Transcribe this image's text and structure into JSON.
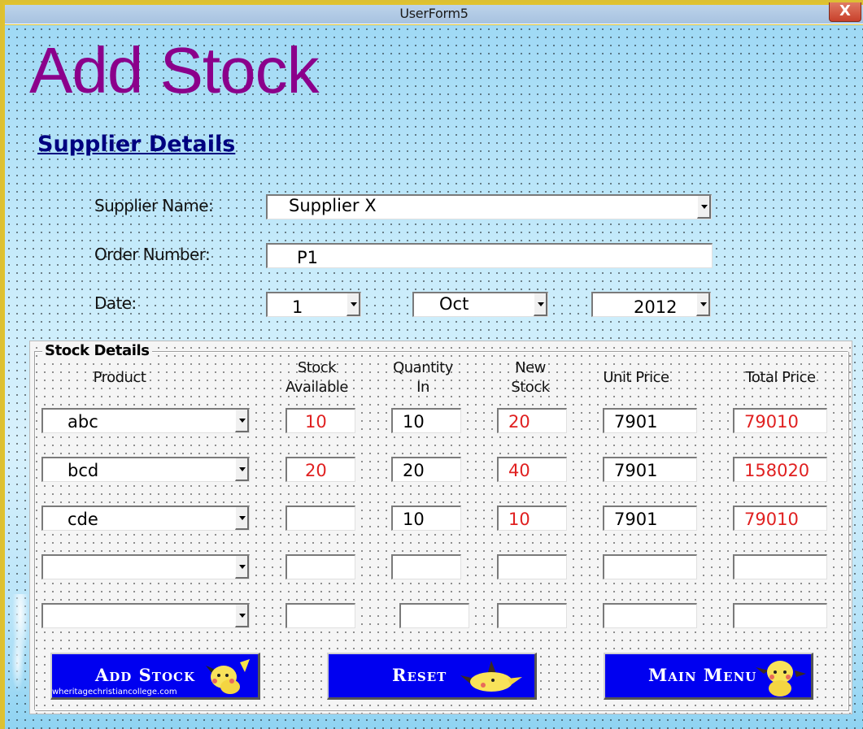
{
  "window": {
    "title": "UserForm5",
    "close_label": "X"
  },
  "heading": "Add Stock",
  "supplier_section": {
    "title": "Supplier Details",
    "supplier_name_label": "Supplier Name:",
    "supplier_name_value": "Supplier X",
    "order_number_label": "Order Number:",
    "order_number_value": "P1",
    "date_label": "Date:",
    "date_day": "1",
    "date_month": "Oct",
    "date_year": "2012"
  },
  "stock_section": {
    "caption": "Stock Details",
    "columns": {
      "product": "Product",
      "stock_available_line1": "Stock",
      "stock_available_line2": "Available",
      "quantity_in_line1": "Quantity",
      "quantity_in_line2": "In",
      "new_stock_line1": "New",
      "new_stock_line2": "Stock",
      "unit_price": "Unit Price",
      "total_price": "Total Price"
    },
    "rows": [
      {
        "product": "abc",
        "stock_available": "10",
        "quantity_in": "10",
        "new_stock": "20",
        "unit_price": "7901",
        "total_price": "79010"
      },
      {
        "product": "bcd",
        "stock_available": "20",
        "quantity_in": "20",
        "new_stock": "40",
        "unit_price": "7901",
        "total_price": "158020"
      },
      {
        "product": "cde",
        "stock_available": "",
        "quantity_in": "10",
        "new_stock": "10",
        "unit_price": "7901",
        "total_price": "79010"
      },
      {
        "product": "",
        "stock_available": "",
        "quantity_in": "",
        "new_stock": "",
        "unit_price": "",
        "total_price": ""
      },
      {
        "product": "",
        "stock_available": "",
        "quantity_in": "",
        "new_stock": "",
        "unit_price": "",
        "total_price": ""
      }
    ]
  },
  "buttons": {
    "add_stock": "Add Stock",
    "reset": "Reset",
    "main_menu": "Main Menu"
  },
  "watermark": "wheritagechristiancollege.com",
  "colors": {
    "heading": "#8b008b",
    "section_title": "#000080",
    "computed_value": "#e02020",
    "button_bg": "#0000f0"
  }
}
